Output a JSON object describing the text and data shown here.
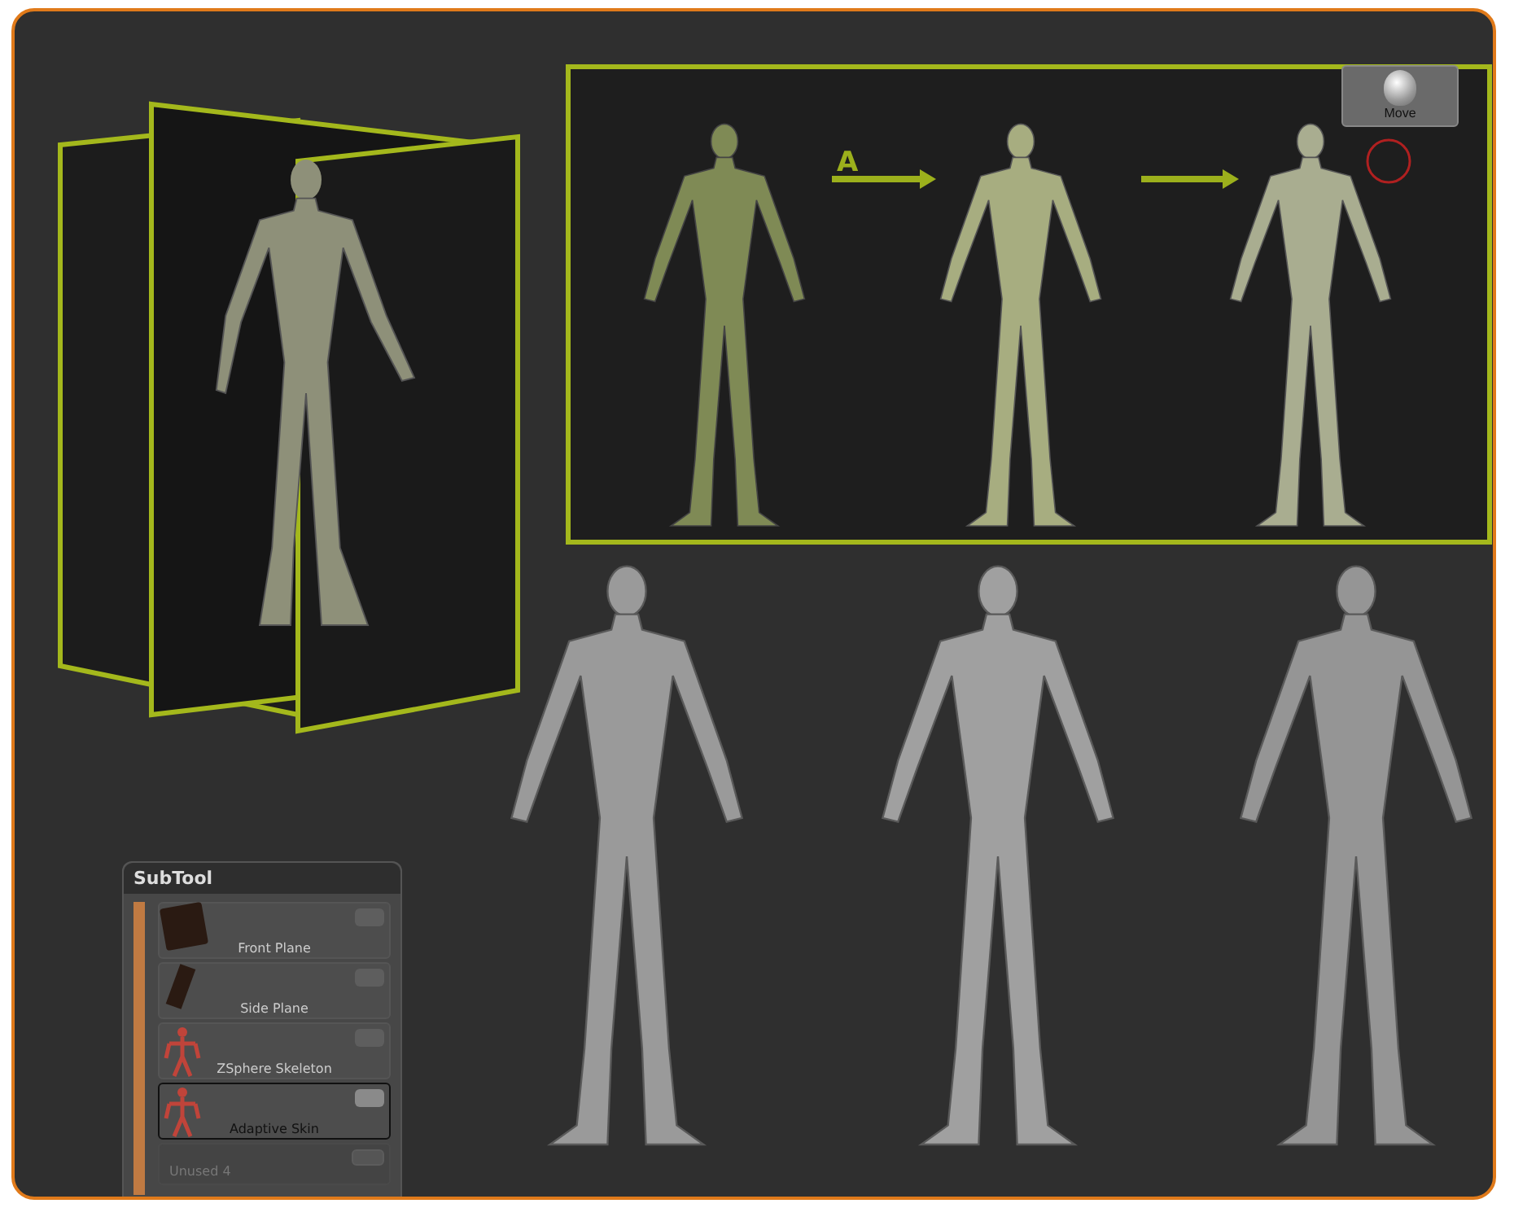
{
  "sequence_panel": {
    "step_label": "A",
    "brush_button": {
      "label": "Move"
    }
  },
  "subtool": {
    "title": "SubTool",
    "items": [
      {
        "label": "Front Plane",
        "selected": false,
        "disabled": false,
        "kind": "front"
      },
      {
        "label": "Side Plane",
        "selected": false,
        "disabled": false,
        "kind": "side"
      },
      {
        "label": "ZSphere Skeleton",
        "selected": false,
        "disabled": false,
        "kind": "skeleton"
      },
      {
        "label": "Adaptive Skin",
        "selected": true,
        "disabled": false,
        "kind": "skeleton"
      },
      {
        "label": "Unused 4",
        "selected": false,
        "disabled": true,
        "kind": "empty"
      }
    ]
  }
}
